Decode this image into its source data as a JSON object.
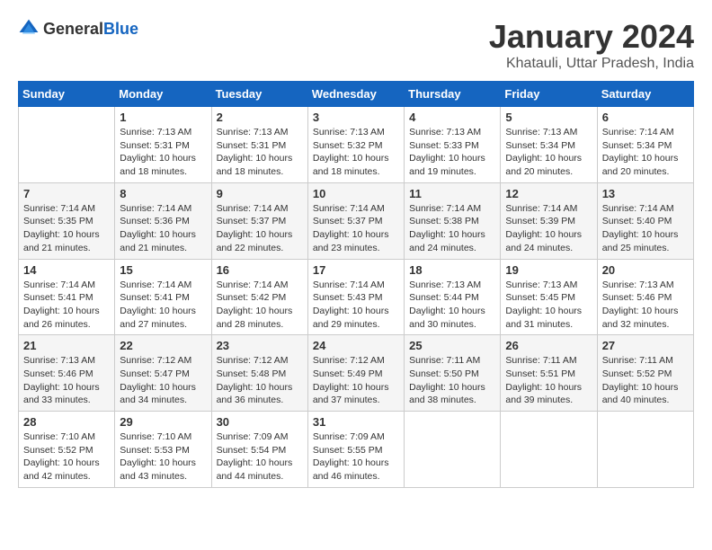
{
  "logo": {
    "text_general": "General",
    "text_blue": "Blue"
  },
  "title": "January 2024",
  "location": "Khatauli, Uttar Pradesh, India",
  "days_of_week": [
    "Sunday",
    "Monday",
    "Tuesday",
    "Wednesday",
    "Thursday",
    "Friday",
    "Saturday"
  ],
  "weeks": [
    [
      {
        "day": "",
        "info": ""
      },
      {
        "day": "1",
        "info": "Sunrise: 7:13 AM\nSunset: 5:31 PM\nDaylight: 10 hours\nand 18 minutes."
      },
      {
        "day": "2",
        "info": "Sunrise: 7:13 AM\nSunset: 5:31 PM\nDaylight: 10 hours\nand 18 minutes."
      },
      {
        "day": "3",
        "info": "Sunrise: 7:13 AM\nSunset: 5:32 PM\nDaylight: 10 hours\nand 18 minutes."
      },
      {
        "day": "4",
        "info": "Sunrise: 7:13 AM\nSunset: 5:33 PM\nDaylight: 10 hours\nand 19 minutes."
      },
      {
        "day": "5",
        "info": "Sunrise: 7:13 AM\nSunset: 5:34 PM\nDaylight: 10 hours\nand 20 minutes."
      },
      {
        "day": "6",
        "info": "Sunrise: 7:14 AM\nSunset: 5:34 PM\nDaylight: 10 hours\nand 20 minutes."
      }
    ],
    [
      {
        "day": "7",
        "info": "Sunrise: 7:14 AM\nSunset: 5:35 PM\nDaylight: 10 hours\nand 21 minutes."
      },
      {
        "day": "8",
        "info": "Sunrise: 7:14 AM\nSunset: 5:36 PM\nDaylight: 10 hours\nand 21 minutes."
      },
      {
        "day": "9",
        "info": "Sunrise: 7:14 AM\nSunset: 5:37 PM\nDaylight: 10 hours\nand 22 minutes."
      },
      {
        "day": "10",
        "info": "Sunrise: 7:14 AM\nSunset: 5:37 PM\nDaylight: 10 hours\nand 23 minutes."
      },
      {
        "day": "11",
        "info": "Sunrise: 7:14 AM\nSunset: 5:38 PM\nDaylight: 10 hours\nand 24 minutes."
      },
      {
        "day": "12",
        "info": "Sunrise: 7:14 AM\nSunset: 5:39 PM\nDaylight: 10 hours\nand 24 minutes."
      },
      {
        "day": "13",
        "info": "Sunrise: 7:14 AM\nSunset: 5:40 PM\nDaylight: 10 hours\nand 25 minutes."
      }
    ],
    [
      {
        "day": "14",
        "info": "Sunrise: 7:14 AM\nSunset: 5:41 PM\nDaylight: 10 hours\nand 26 minutes."
      },
      {
        "day": "15",
        "info": "Sunrise: 7:14 AM\nSunset: 5:41 PM\nDaylight: 10 hours\nand 27 minutes."
      },
      {
        "day": "16",
        "info": "Sunrise: 7:14 AM\nSunset: 5:42 PM\nDaylight: 10 hours\nand 28 minutes."
      },
      {
        "day": "17",
        "info": "Sunrise: 7:14 AM\nSunset: 5:43 PM\nDaylight: 10 hours\nand 29 minutes."
      },
      {
        "day": "18",
        "info": "Sunrise: 7:13 AM\nSunset: 5:44 PM\nDaylight: 10 hours\nand 30 minutes."
      },
      {
        "day": "19",
        "info": "Sunrise: 7:13 AM\nSunset: 5:45 PM\nDaylight: 10 hours\nand 31 minutes."
      },
      {
        "day": "20",
        "info": "Sunrise: 7:13 AM\nSunset: 5:46 PM\nDaylight: 10 hours\nand 32 minutes."
      }
    ],
    [
      {
        "day": "21",
        "info": "Sunrise: 7:13 AM\nSunset: 5:46 PM\nDaylight: 10 hours\nand 33 minutes."
      },
      {
        "day": "22",
        "info": "Sunrise: 7:12 AM\nSunset: 5:47 PM\nDaylight: 10 hours\nand 34 minutes."
      },
      {
        "day": "23",
        "info": "Sunrise: 7:12 AM\nSunset: 5:48 PM\nDaylight: 10 hours\nand 36 minutes."
      },
      {
        "day": "24",
        "info": "Sunrise: 7:12 AM\nSunset: 5:49 PM\nDaylight: 10 hours\nand 37 minutes."
      },
      {
        "day": "25",
        "info": "Sunrise: 7:11 AM\nSunset: 5:50 PM\nDaylight: 10 hours\nand 38 minutes."
      },
      {
        "day": "26",
        "info": "Sunrise: 7:11 AM\nSunset: 5:51 PM\nDaylight: 10 hours\nand 39 minutes."
      },
      {
        "day": "27",
        "info": "Sunrise: 7:11 AM\nSunset: 5:52 PM\nDaylight: 10 hours\nand 40 minutes."
      }
    ],
    [
      {
        "day": "28",
        "info": "Sunrise: 7:10 AM\nSunset: 5:52 PM\nDaylight: 10 hours\nand 42 minutes."
      },
      {
        "day": "29",
        "info": "Sunrise: 7:10 AM\nSunset: 5:53 PM\nDaylight: 10 hours\nand 43 minutes."
      },
      {
        "day": "30",
        "info": "Sunrise: 7:09 AM\nSunset: 5:54 PM\nDaylight: 10 hours\nand 44 minutes."
      },
      {
        "day": "31",
        "info": "Sunrise: 7:09 AM\nSunset: 5:55 PM\nDaylight: 10 hours\nand 46 minutes."
      },
      {
        "day": "",
        "info": ""
      },
      {
        "day": "",
        "info": ""
      },
      {
        "day": "",
        "info": ""
      }
    ]
  ]
}
